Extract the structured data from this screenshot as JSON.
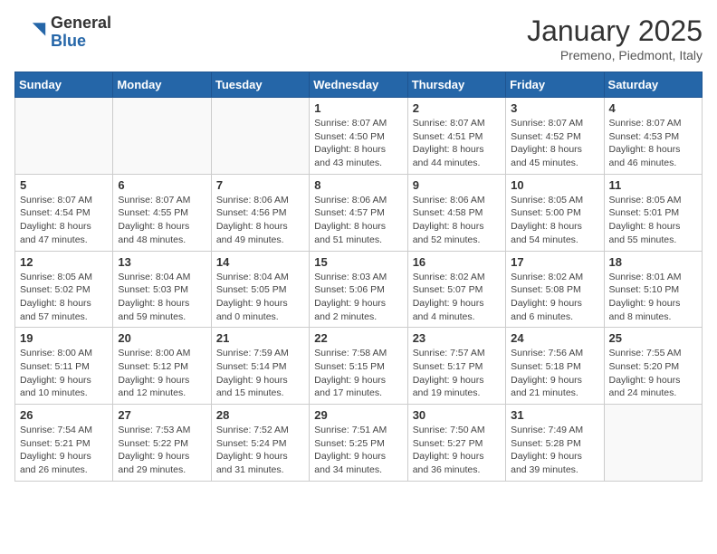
{
  "header": {
    "logo_general": "General",
    "logo_blue": "Blue",
    "month_title": "January 2025",
    "subtitle": "Premeno, Piedmont, Italy"
  },
  "days_of_week": [
    "Sunday",
    "Monday",
    "Tuesday",
    "Wednesday",
    "Thursday",
    "Friday",
    "Saturday"
  ],
  "weeks": [
    [
      {
        "day": "",
        "info": ""
      },
      {
        "day": "",
        "info": ""
      },
      {
        "day": "",
        "info": ""
      },
      {
        "day": "1",
        "info": "Sunrise: 8:07 AM\nSunset: 4:50 PM\nDaylight: 8 hours and 43 minutes."
      },
      {
        "day": "2",
        "info": "Sunrise: 8:07 AM\nSunset: 4:51 PM\nDaylight: 8 hours and 44 minutes."
      },
      {
        "day": "3",
        "info": "Sunrise: 8:07 AM\nSunset: 4:52 PM\nDaylight: 8 hours and 45 minutes."
      },
      {
        "day": "4",
        "info": "Sunrise: 8:07 AM\nSunset: 4:53 PM\nDaylight: 8 hours and 46 minutes."
      }
    ],
    [
      {
        "day": "5",
        "info": "Sunrise: 8:07 AM\nSunset: 4:54 PM\nDaylight: 8 hours and 47 minutes."
      },
      {
        "day": "6",
        "info": "Sunrise: 8:07 AM\nSunset: 4:55 PM\nDaylight: 8 hours and 48 minutes."
      },
      {
        "day": "7",
        "info": "Sunrise: 8:06 AM\nSunset: 4:56 PM\nDaylight: 8 hours and 49 minutes."
      },
      {
        "day": "8",
        "info": "Sunrise: 8:06 AM\nSunset: 4:57 PM\nDaylight: 8 hours and 51 minutes."
      },
      {
        "day": "9",
        "info": "Sunrise: 8:06 AM\nSunset: 4:58 PM\nDaylight: 8 hours and 52 minutes."
      },
      {
        "day": "10",
        "info": "Sunrise: 8:05 AM\nSunset: 5:00 PM\nDaylight: 8 hours and 54 minutes."
      },
      {
        "day": "11",
        "info": "Sunrise: 8:05 AM\nSunset: 5:01 PM\nDaylight: 8 hours and 55 minutes."
      }
    ],
    [
      {
        "day": "12",
        "info": "Sunrise: 8:05 AM\nSunset: 5:02 PM\nDaylight: 8 hours and 57 minutes."
      },
      {
        "day": "13",
        "info": "Sunrise: 8:04 AM\nSunset: 5:03 PM\nDaylight: 8 hours and 59 minutes."
      },
      {
        "day": "14",
        "info": "Sunrise: 8:04 AM\nSunset: 5:05 PM\nDaylight: 9 hours and 0 minutes."
      },
      {
        "day": "15",
        "info": "Sunrise: 8:03 AM\nSunset: 5:06 PM\nDaylight: 9 hours and 2 minutes."
      },
      {
        "day": "16",
        "info": "Sunrise: 8:02 AM\nSunset: 5:07 PM\nDaylight: 9 hours and 4 minutes."
      },
      {
        "day": "17",
        "info": "Sunrise: 8:02 AM\nSunset: 5:08 PM\nDaylight: 9 hours and 6 minutes."
      },
      {
        "day": "18",
        "info": "Sunrise: 8:01 AM\nSunset: 5:10 PM\nDaylight: 9 hours and 8 minutes."
      }
    ],
    [
      {
        "day": "19",
        "info": "Sunrise: 8:00 AM\nSunset: 5:11 PM\nDaylight: 9 hours and 10 minutes."
      },
      {
        "day": "20",
        "info": "Sunrise: 8:00 AM\nSunset: 5:12 PM\nDaylight: 9 hours and 12 minutes."
      },
      {
        "day": "21",
        "info": "Sunrise: 7:59 AM\nSunset: 5:14 PM\nDaylight: 9 hours and 15 minutes."
      },
      {
        "day": "22",
        "info": "Sunrise: 7:58 AM\nSunset: 5:15 PM\nDaylight: 9 hours and 17 minutes."
      },
      {
        "day": "23",
        "info": "Sunrise: 7:57 AM\nSunset: 5:17 PM\nDaylight: 9 hours and 19 minutes."
      },
      {
        "day": "24",
        "info": "Sunrise: 7:56 AM\nSunset: 5:18 PM\nDaylight: 9 hours and 21 minutes."
      },
      {
        "day": "25",
        "info": "Sunrise: 7:55 AM\nSunset: 5:20 PM\nDaylight: 9 hours and 24 minutes."
      }
    ],
    [
      {
        "day": "26",
        "info": "Sunrise: 7:54 AM\nSunset: 5:21 PM\nDaylight: 9 hours and 26 minutes."
      },
      {
        "day": "27",
        "info": "Sunrise: 7:53 AM\nSunset: 5:22 PM\nDaylight: 9 hours and 29 minutes."
      },
      {
        "day": "28",
        "info": "Sunrise: 7:52 AM\nSunset: 5:24 PM\nDaylight: 9 hours and 31 minutes."
      },
      {
        "day": "29",
        "info": "Sunrise: 7:51 AM\nSunset: 5:25 PM\nDaylight: 9 hours and 34 minutes."
      },
      {
        "day": "30",
        "info": "Sunrise: 7:50 AM\nSunset: 5:27 PM\nDaylight: 9 hours and 36 minutes."
      },
      {
        "day": "31",
        "info": "Sunrise: 7:49 AM\nSunset: 5:28 PM\nDaylight: 9 hours and 39 minutes."
      },
      {
        "day": "",
        "info": ""
      }
    ]
  ]
}
